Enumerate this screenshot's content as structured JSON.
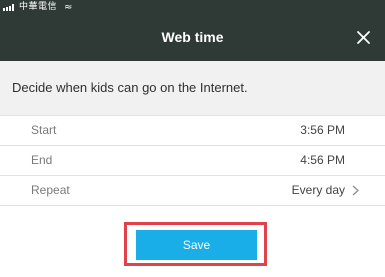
{
  "status_bar": {
    "carrier": "中華電信",
    "signal_icon": "signal-bars-icon",
    "wifi_icon": "wifi-icon"
  },
  "header": {
    "title": "Web time",
    "close_icon": "close-icon",
    "background_color": "#2f3a37"
  },
  "description": "Decide when kids can go on the Internet.",
  "settings": {
    "start": {
      "label": "Start",
      "value": "3:56 PM"
    },
    "end": {
      "label": "End",
      "value": "4:56 PM"
    },
    "repeat": {
      "label": "Repeat",
      "value": "Every day",
      "icon": "chevron-right-icon"
    }
  },
  "save_button": {
    "label": "Save",
    "color": "#1aaee9",
    "highlight_color": "#e0424b"
  }
}
